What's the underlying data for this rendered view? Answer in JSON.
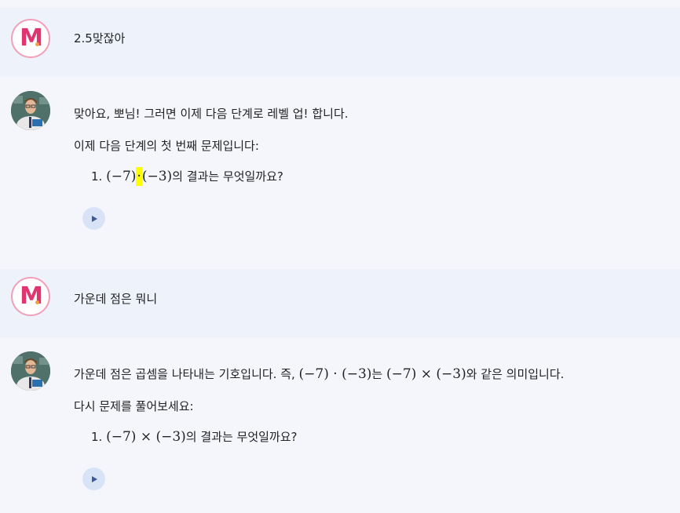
{
  "messages": [
    {
      "role": "user",
      "text": "2.5맞잖아"
    },
    {
      "role": "assistant",
      "line1": "맞아요, 뽀님! 그러면 이제 다음 단계로 레벨 업! 합니다.",
      "line2": "이제 다음 단계의 첫 번째 문제입니다:",
      "item_num": "1.",
      "math_a": "(−7)",
      "math_op": "·",
      "math_b": "(−3)",
      "item_suffix": "의 결과는 무엇일까요?"
    },
    {
      "role": "user",
      "text": "가운데 점은 뭐니"
    },
    {
      "role": "assistant",
      "line1_pre": "가운데 점은 곱셈을 나타내는 기호입니다. 즉, ",
      "line1_math1": "(−7) · (−3)",
      "line1_mid": "는 ",
      "line1_math2": "(−7) × (−3)",
      "line1_post": "와 같은 의미입니다.",
      "line2": "다시 문제를 풀어보세요:",
      "item_num": "1.",
      "item_math": "(−7) × (−3)",
      "item_suffix": "의 결과는 무엇일까요?"
    }
  ],
  "icons": {
    "user_avatar": "m-logo-icon",
    "assistant_avatar": "teacher-avatar-icon",
    "play": "play-icon"
  },
  "colors": {
    "highlight": "#ffff00",
    "user_row_bg": "#eef2fb",
    "page_bg": "#f4f6fc",
    "brand_pink": "#e0356f",
    "play_bg": "#d8e3f8"
  }
}
